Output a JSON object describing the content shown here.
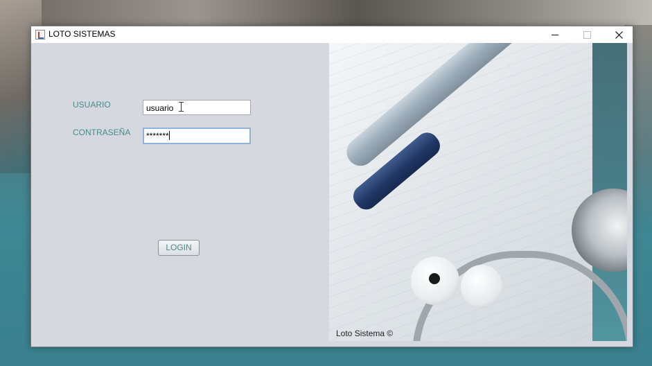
{
  "window": {
    "title": "LOTO SISTEMAS"
  },
  "login_form": {
    "username_label": "USUARIO",
    "username_value": "usuario",
    "password_label": "CONTRASEÑA",
    "password_value": "*******",
    "login_button": "LOGIN"
  },
  "image_panel": {
    "caption": "Loto Sistema ©"
  }
}
